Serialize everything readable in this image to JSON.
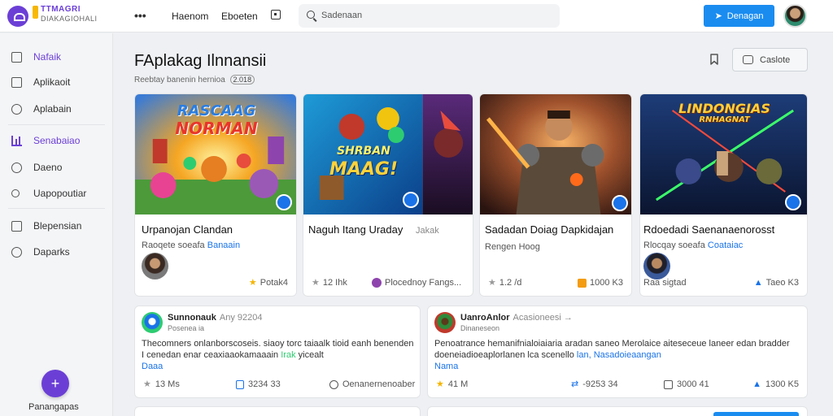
{
  "app": {
    "logo_line1": "TTMAGRI",
    "logo_line2": "DIAKAGIOHALI"
  },
  "topnav": {
    "more": "•••",
    "link1": "Haenom",
    "link2": "Eboeten",
    "search_placeholder": "Sadenaan",
    "primary_button": "Denagan"
  },
  "sidebar": {
    "items": [
      {
        "label": "Nafaik",
        "icon": "layers-icon",
        "active": true
      },
      {
        "label": "Aplikaoit",
        "icon": "square-icon"
      },
      {
        "label": "Aplabain",
        "icon": "emoji-icon"
      },
      {
        "label": "Senabaiao",
        "icon": "bar-chart-icon",
        "active": true
      },
      {
        "label": "Daeno",
        "icon": "clock-icon"
      },
      {
        "label": "Uapopoutiar",
        "icon": "search-icon"
      },
      {
        "label": "Blepensian",
        "icon": "document-icon"
      },
      {
        "label": "Daparks",
        "icon": "clock-icon"
      }
    ],
    "fab_label": "Panangapas",
    "fab_icon": "+"
  },
  "header": {
    "title": "FAplakag Ilnnansii",
    "subtitle": "Reebtay banenin hernioa",
    "subtitle_badge": "2.018",
    "action_button": "Caslote"
  },
  "cards": [
    {
      "art_line1": "RASCAAG",
      "art_line2": "NORMAN",
      "title": "Urpanojan Clandan",
      "sub": "Raoqete soeafa ",
      "sub_highlight": "Banaain",
      "stat": "Potak4"
    },
    {
      "art_line1": "SHRBAN",
      "art_line2": "MAAG!",
      "title": "Naguh Itang Uraday",
      "title_extra": "Jakak",
      "stat1": "12 Ihk",
      "stat2": "Plocednoy Fangs..."
    },
    {
      "title": "Sadadan Doiag Dapkidajan",
      "sub": "Rengen Hoog",
      "stat1": "1.2 /d",
      "stat2": "1000 K3"
    },
    {
      "art_line1": "LINDONGIAS",
      "art_line2": "RNHAGNAT",
      "title": "Rdoedadi Saenanaenorosst",
      "sub": "Rlocqay soeafa ",
      "sub_highlight": "Coataiac",
      "stat1": "Raa sigtad",
      "stat2": "Taeo K3"
    }
  ],
  "posts": [
    {
      "name": "Sunnonauk",
      "name_meta": "Any 92204",
      "handle": "Posenea ia",
      "body": "Thecomners onlanborscoseis. siaoy torc taiaalk tioid eanh benenden I cenedan enar ceaxiaaokamaaain ",
      "body_link": "Irak",
      "body_tail": " yicealt",
      "body_link2": "Daaa",
      "stat1": "13 Ms",
      "stat2": "3234 33",
      "stat3": "Oenanernenoaber"
    },
    {
      "name": "UanroAnlor",
      "name_meta": "Acasioneesi →",
      "handle": "Dinaneseon",
      "body": "Penoatrance hemanifnialoiaiaria aradan saneo Merolaice aiteseceue laneer edan bradder doeneiadioeaplorlanen lca scenello",
      "body_link": "lan, Nasadoieaangan",
      "body_link2": "Nama",
      "stat1": "41 M",
      "stat2": "-9253 34",
      "stat3": "3000 41",
      "stat4": "1300 K5"
    }
  ],
  "colors": {
    "accent": "#6b3fd6",
    "primary": "#1a8cf0",
    "link": "#1a73e8",
    "star": "#f4b400"
  }
}
